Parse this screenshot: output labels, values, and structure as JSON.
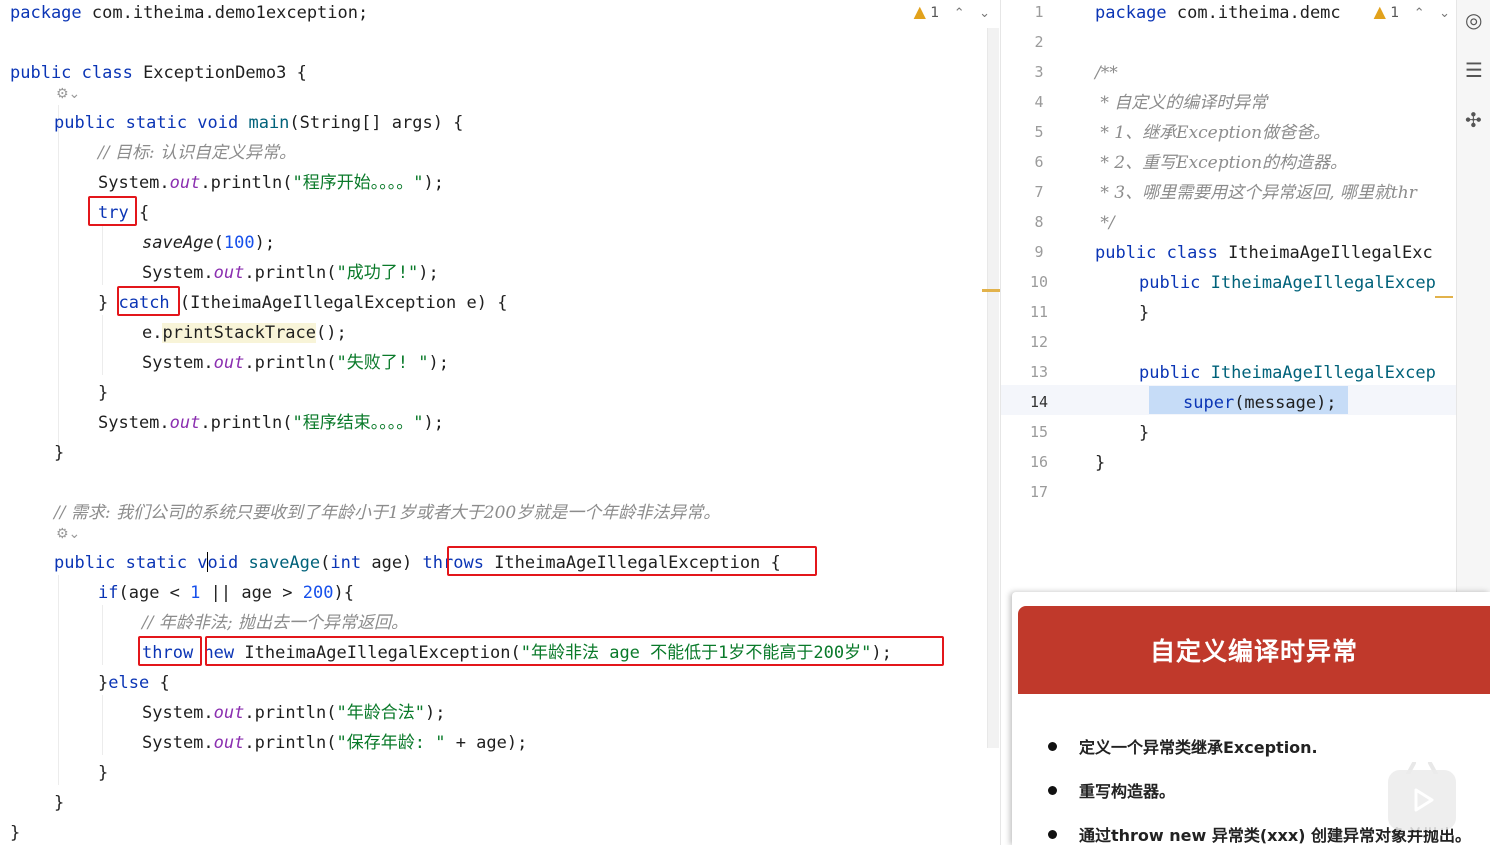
{
  "left_editor": {
    "inspection": {
      "warning_count": "1"
    },
    "lines": [
      [
        {
          "t": "package ",
          "c": "kw"
        },
        {
          "t": "com.itheima.demo1exception;"
        }
      ],
      [
        {
          "t": "public class ",
          "c": "kw"
        },
        {
          "t": "ExceptionDemo3 {"
        }
      ],
      [
        {
          "t": "public static void ",
          "c": "kw"
        },
        {
          "t": "main",
          "c": "fn"
        },
        {
          "t": "(String[] args) {"
        }
      ],
      [
        {
          "t": "// 目标: 认识自定义异常。",
          "c": "cmt"
        }
      ],
      [
        {
          "t": "System."
        },
        {
          "t": "out",
          "c": "field"
        },
        {
          "t": ".println("
        },
        {
          "t": "\"程序开始。。。。\"",
          "c": "str"
        },
        {
          "t": ");"
        }
      ],
      [
        {
          "t": "try",
          "c": "kw"
        },
        {
          "t": " {"
        }
      ],
      [
        {
          "t": "saveAge",
          "c": "ital"
        },
        {
          "t": "("
        },
        {
          "t": "100",
          "c": "num"
        },
        {
          "t": ");"
        }
      ],
      [
        {
          "t": "System."
        },
        {
          "t": "out",
          "c": "field"
        },
        {
          "t": ".println("
        },
        {
          "t": "\"成功了!\"",
          "c": "str"
        },
        {
          "t": ");"
        }
      ],
      [
        {
          "t": "} "
        },
        {
          "t": "catch",
          "c": "kw"
        },
        {
          "t": " (ItheimaAgeIllegalException e) {"
        }
      ],
      [
        {
          "t": "e."
        },
        {
          "t": "printStackTrace",
          "c": "meth-call"
        },
        {
          "t": "();"
        }
      ],
      [
        {
          "t": "System."
        },
        {
          "t": "out",
          "c": "field"
        },
        {
          "t": ".println("
        },
        {
          "t": "\"失败了! \"",
          "c": "str"
        },
        {
          "t": ");"
        }
      ],
      [
        {
          "t": "}"
        }
      ],
      [
        {
          "t": "System."
        },
        {
          "t": "out",
          "c": "field"
        },
        {
          "t": ".println("
        },
        {
          "t": "\"程序结束。。。。\"",
          "c": "str"
        },
        {
          "t": ");"
        }
      ],
      [
        {
          "t": "}"
        }
      ],
      [
        {
          "t": "// 需求: 我们公司的系统只要收到了年龄小于1岁或者大于200岁就是一个年龄非法异常。",
          "c": "cmt"
        }
      ],
      [
        {
          "t": "public static ",
          "c": "kw"
        },
        {
          "t": "void ",
          "c": "kw"
        },
        {
          "t": "saveAge",
          "c": "fn"
        },
        {
          "t": "("
        },
        {
          "t": "int ",
          "c": "kw"
        },
        {
          "t": "age) "
        },
        {
          "t": "throws ",
          "c": "kw"
        },
        {
          "t": "ItheimaAgeIllegalException"
        },
        {
          "t": " {"
        }
      ],
      [
        {
          "t": "if",
          "c": "kw"
        },
        {
          "t": "(age < "
        },
        {
          "t": "1",
          "c": "num"
        },
        {
          "t": " || age > "
        },
        {
          "t": "200",
          "c": "num"
        },
        {
          "t": "){"
        }
      ],
      [
        {
          "t": "// 年龄非法; 抛出去一个异常返回。",
          "c": "cmt"
        }
      ],
      [
        {
          "t": "throw",
          "c": "kw"
        },
        {
          "t": " "
        },
        {
          "t": "new ",
          "c": "kw"
        },
        {
          "t": "ItheimaAgeIllegalException("
        },
        {
          "t": "\"年龄非法 age 不能低于1岁不能高于200岁\"",
          "c": "str"
        },
        {
          "t": ");"
        }
      ],
      [
        {
          "t": "}"
        },
        {
          "t": "else",
          "c": "kw"
        },
        {
          "t": " {"
        }
      ],
      [
        {
          "t": "System."
        },
        {
          "t": "out",
          "c": "field"
        },
        {
          "t": ".println("
        },
        {
          "t": "\"年龄合法\"",
          "c": "str"
        },
        {
          "t": ");"
        }
      ],
      [
        {
          "t": "System."
        },
        {
          "t": "out",
          "c": "field"
        },
        {
          "t": ".println("
        },
        {
          "t": "\"保存年龄: \"",
          "c": "str"
        },
        {
          "t": " + age);"
        }
      ],
      [
        {
          "t": "}"
        }
      ],
      [
        {
          "t": "}"
        }
      ],
      [
        {
          "t": "}"
        }
      ]
    ]
  },
  "right_editor": {
    "inspection": {
      "warning_count": "1"
    },
    "line_numbers": [
      "1",
      "2",
      "3",
      "4",
      "5",
      "6",
      "7",
      "8",
      "9",
      "10",
      "11",
      "12",
      "13",
      "14",
      "15",
      "16",
      "17"
    ],
    "current_line": "14",
    "lines": [
      [
        {
          "t": "package ",
          "c": "kw"
        },
        {
          "t": "com.itheima.demc"
        }
      ],
      [
        {
          "t": "/**",
          "c": "cmt"
        }
      ],
      [
        {
          "t": " * 自定义的编译时异常",
          "c": "cmt"
        }
      ],
      [
        {
          "t": " * 1、继承Exception做爸爸。",
          "c": "cmt"
        }
      ],
      [
        {
          "t": " * 2、重写Exception的构造器。",
          "c": "cmt"
        }
      ],
      [
        {
          "t": " * 3、哪里需要用这个异常返回, 哪里就thr",
          "c": "cmt"
        }
      ],
      [
        {
          "t": " */",
          "c": "cmt"
        }
      ],
      [
        {
          "t": "public class ",
          "c": "kw"
        },
        {
          "t": "ItheimaAgeIllegalExc"
        }
      ],
      [
        {
          "t": "public ",
          "c": "kw"
        },
        {
          "t": "ItheimaAgeIllegalExcep",
          "c": "fn"
        }
      ],
      [
        {
          "t": "}"
        }
      ],
      [
        {
          "t": "public ",
          "c": "kw"
        },
        {
          "t": "ItheimaAgeIllegalExcep",
          "c": "fn"
        }
      ],
      [
        {
          "t": "super",
          "c": "kw"
        },
        {
          "t": "(message);"
        }
      ],
      [
        {
          "t": "}"
        }
      ],
      [
        {
          "t": "}"
        }
      ]
    ]
  },
  "slide": {
    "title": "自定义编译时异常",
    "bullets": [
      "定义一个异常类继承Exception.",
      "重写构造器。",
      "通过throw new 异常类(xxx) 创建异常对象并抛出。"
    ]
  },
  "colors": {
    "keyword": "#0b35b5",
    "string": "#0a7a2a",
    "number": "#1750eb",
    "highlight_box": "#e3161b",
    "slide_header": "#c0392b"
  }
}
